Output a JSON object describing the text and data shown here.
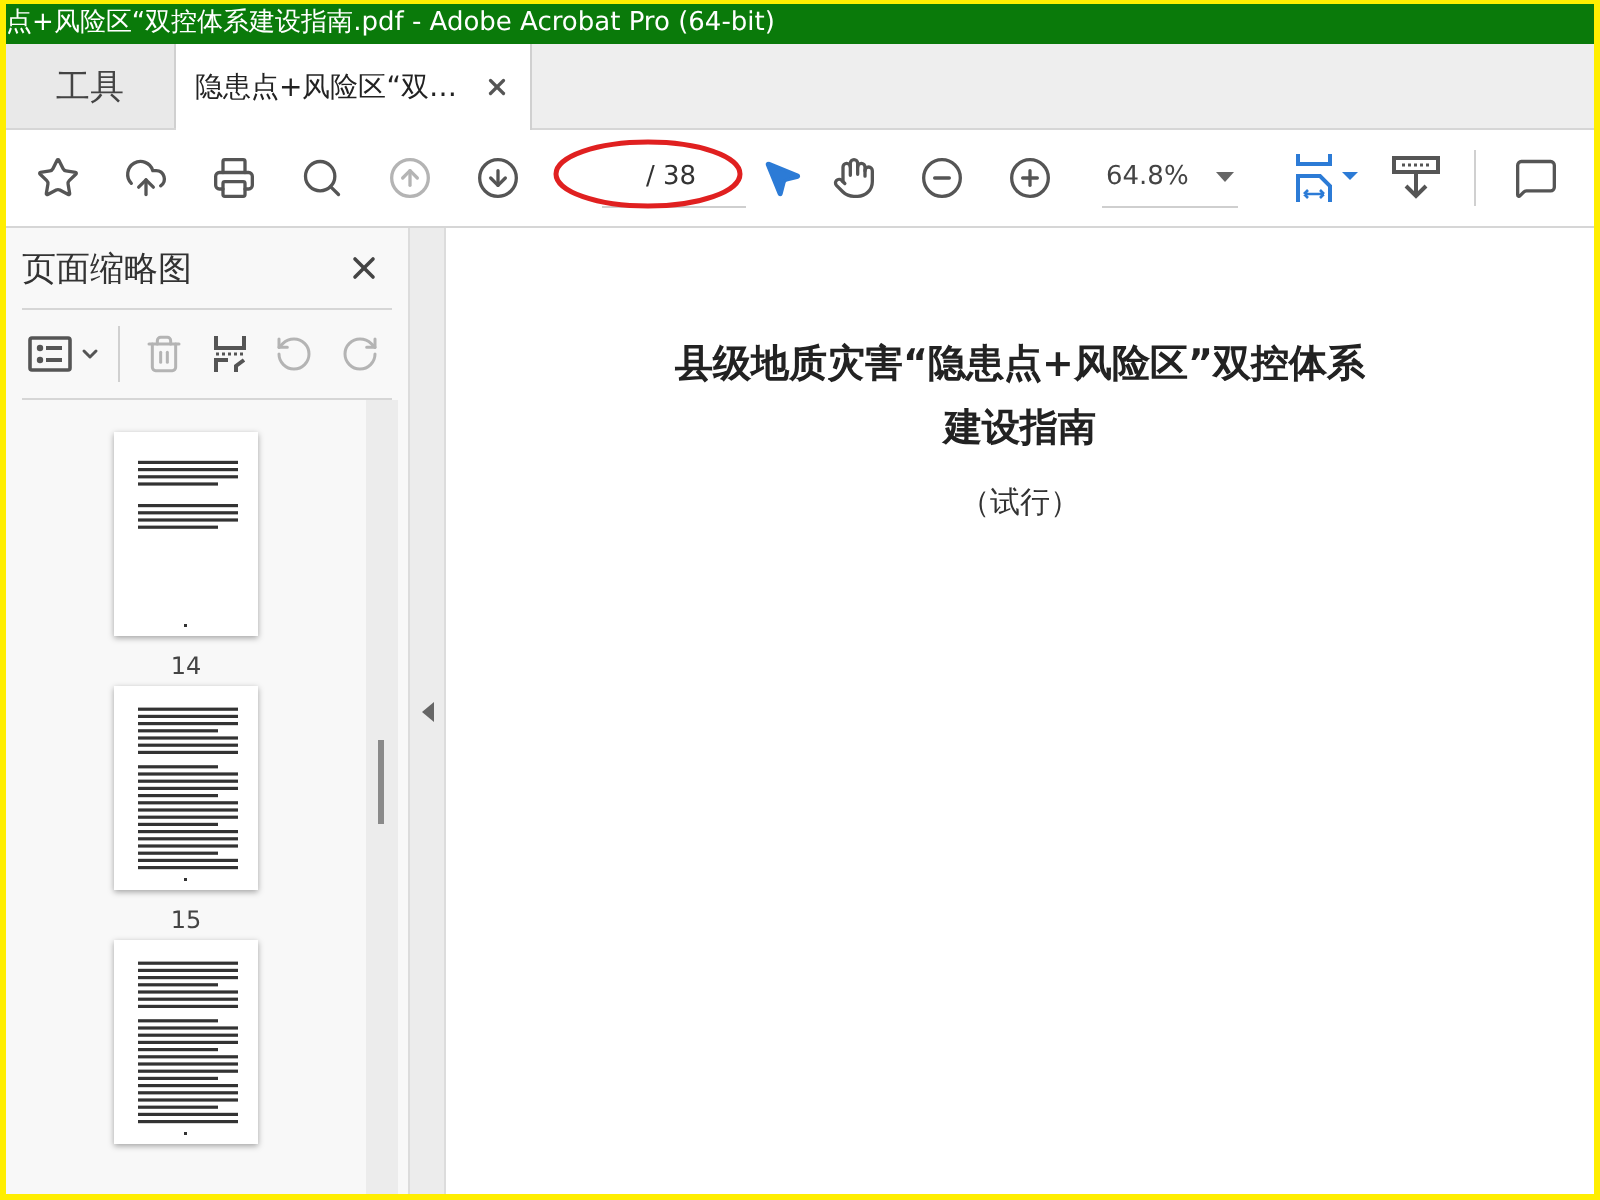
{
  "window": {
    "title": "点+风险区“双控体系建设指南.pdf - Adobe Acrobat Pro (64-bit)"
  },
  "tabs": [
    {
      "label": "工具",
      "selected": false
    },
    {
      "label": "隐患点+风险区“双…",
      "selected": true
    }
  ],
  "toolbar": {
    "buttons": [
      {
        "kind": "star",
        "disabled": false
      },
      {
        "kind": "upload",
        "disabled": false
      },
      {
        "kind": "print",
        "disabled": false
      },
      {
        "kind": "find",
        "disabled": false
      },
      {
        "kind": "prev",
        "disabled": true
      },
      {
        "kind": "next",
        "disabled": false
      }
    ],
    "page_total": "/ 38",
    "tools": [
      {
        "kind": "pointer",
        "selected": true
      },
      {
        "kind": "hand",
        "selected": false
      },
      {
        "kind": "zoom-out",
        "selected": false
      },
      {
        "kind": "zoom-in",
        "selected": false
      }
    ],
    "zoom": "64.8%"
  },
  "sidebar": {
    "title": "页面缩略图",
    "tools": [
      {
        "kind": "options",
        "disabled": false
      },
      {
        "kind": "delete",
        "disabled": true
      },
      {
        "kind": "insert",
        "disabled": false
      },
      {
        "kind": "rotate-left",
        "disabled": true
      },
      {
        "kind": "rotate-right",
        "disabled": true
      }
    ],
    "thumbnails": [
      {
        "label": "14",
        "kind": "sparse"
      },
      {
        "label": "15",
        "kind": "dense"
      },
      {
        "kind": "dense"
      }
    ]
  },
  "document": {
    "title_lines": [
      "县级地质灾害“隐患点+风险区”双控体系",
      "建设指南"
    ],
    "subtitle": "（试行）"
  }
}
